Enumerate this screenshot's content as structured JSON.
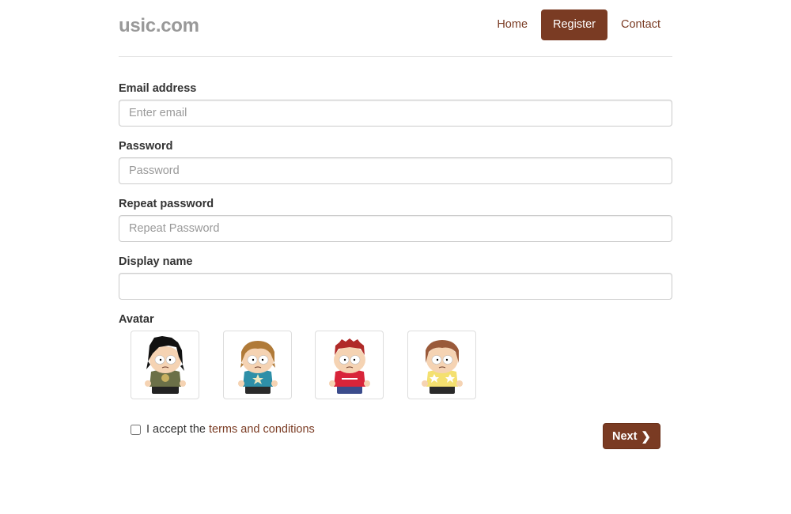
{
  "header": {
    "brand": "usic.com",
    "nav": [
      {
        "label": "Home"
      },
      {
        "label": "Register"
      },
      {
        "label": "Contact"
      }
    ]
  },
  "form": {
    "email": {
      "label": "Email address",
      "placeholder": "Enter email",
      "value": ""
    },
    "password": {
      "label": "Password",
      "placeholder": "Password",
      "value": ""
    },
    "repeat_password": {
      "label": "Repeat password",
      "placeholder": "Repeat Password",
      "value": ""
    },
    "display_name": {
      "label": "Display name",
      "placeholder": "",
      "value": ""
    },
    "avatar": {
      "label": "Avatar",
      "options": [
        {
          "icon": "avatar-black-hair-icon"
        },
        {
          "icon": "avatar-blond-hair-icon"
        },
        {
          "icon": "avatar-red-hair-icon"
        },
        {
          "icon": "avatar-brown-hair-icon"
        }
      ]
    },
    "terms": {
      "prefix": "I accept the",
      "link": "terms and conditions",
      "checked": false
    },
    "next_label": "Next",
    "next_icon": "chevron-right-icon"
  },
  "colors": {
    "accent": "#7a3b23",
    "brand_text": "#999999",
    "border": "#cccccc"
  }
}
